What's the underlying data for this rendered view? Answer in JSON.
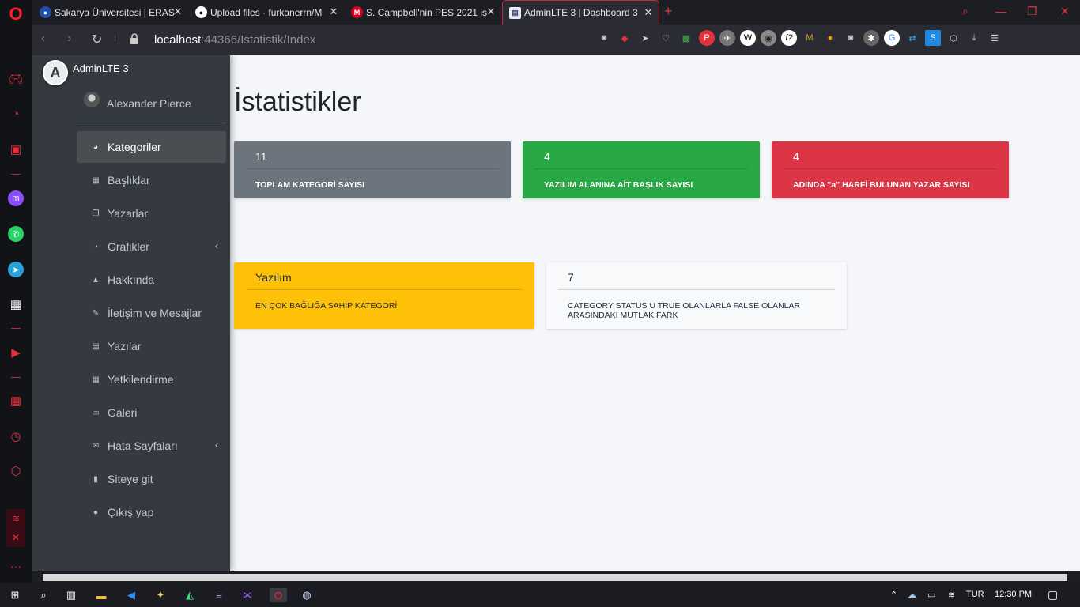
{
  "browser": {
    "tabs": [
      {
        "title": "Sakarya Üniversitesi | ERAS",
        "favicon": "globe-icon",
        "active": false
      },
      {
        "title": "Upload files · furkanerrn/M",
        "favicon": "github-icon",
        "active": false
      },
      {
        "title": "S. Campbell'nin PES 2021 is",
        "favicon": "m-icon",
        "active": false
      },
      {
        "title": "AdminLTE 3 | Dashboard 3",
        "favicon": "page-icon",
        "active": true
      }
    ],
    "url_host": "localhost",
    "url_rest": ":44366/Istatistik/Index"
  },
  "sidebar": {
    "brand": "AdminLTE 3",
    "user": "Alexander Pierce",
    "items": [
      {
        "label": "Kategoriler",
        "icon": "dashboard-icon",
        "active": true,
        "caret": false
      },
      {
        "label": "Başlıklar",
        "icon": "th-icon",
        "active": false,
        "caret": false
      },
      {
        "label": "Yazarlar",
        "icon": "copy-icon",
        "active": false,
        "caret": false
      },
      {
        "label": "Grafikler",
        "icon": "chart-pie-icon",
        "active": false,
        "caret": true
      },
      {
        "label": "Hakkında",
        "icon": "tree-icon",
        "active": false,
        "caret": false
      },
      {
        "label": "İletişim ve Mesajlar",
        "icon": "edit-icon",
        "active": false,
        "caret": false
      },
      {
        "label": "Yazılar",
        "icon": "table-icon",
        "active": false,
        "caret": false
      },
      {
        "label": "Yetkilendirme",
        "icon": "calendar-icon",
        "active": false,
        "caret": false
      },
      {
        "label": "Galeri",
        "icon": "image-icon",
        "active": false,
        "caret": false
      },
      {
        "label": "Hata Sayfaları",
        "icon": "envelope-icon",
        "active": false,
        "caret": true
      },
      {
        "label": "Siteye git",
        "icon": "book-icon",
        "active": false,
        "caret": false
      },
      {
        "label": "Çıkış yap",
        "icon": "apple-icon",
        "active": false,
        "caret": false
      }
    ]
  },
  "page": {
    "title": "İstatistikler",
    "cards": [
      {
        "value": "11",
        "label": "TOPLAM KATEGORİ SAYISI",
        "color": "#6c757d"
      },
      {
        "value": "4",
        "label": "YAZILIM ALANINA AİT BAŞLIK SAYISI",
        "color": "#28a745"
      },
      {
        "value": "4",
        "label": "ADINDA \"a\" HARFİ BULUNAN YAZAR SAYISI",
        "color": "#dc3545"
      },
      {
        "value": "Yazılım",
        "label": "EN ÇOK BAĞLIĞA SAHİP KATEGORİ",
        "color": "#ffc107"
      },
      {
        "value": "7",
        "label": "CATEGORY STATUS U TRUE OLANLARLA FALSE OLANLAR ARASINDAKİ MUTLAK FARK",
        "color": "#f8f9fa"
      }
    ]
  },
  "taskbar": {
    "language": "TUR",
    "time": "12:30 PM"
  }
}
